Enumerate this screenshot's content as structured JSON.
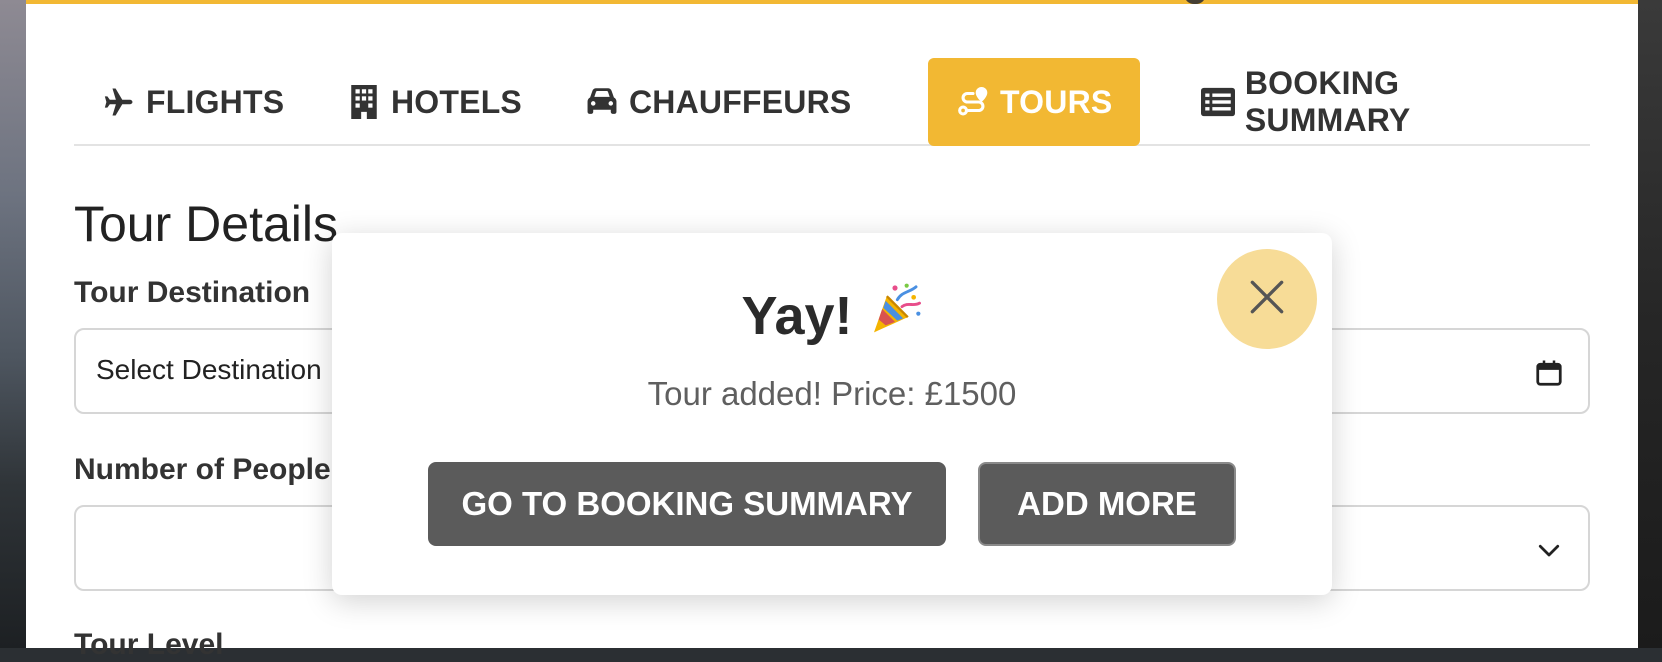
{
  "colors": {
    "accent": "#f2b833",
    "close_bg": "#f7dc97",
    "button_bg": "#5b5b5b",
    "text_dark": "#333333"
  },
  "tabs": [
    {
      "label": "FLIGHTS",
      "icon": "plane-icon",
      "active": false
    },
    {
      "label": "HOTELS",
      "icon": "building-icon",
      "active": false
    },
    {
      "label": "CHAUFFEURS",
      "icon": "car-icon",
      "active": false
    },
    {
      "label": "TOURS",
      "icon": "route-icon",
      "active": true
    },
    {
      "label": "BOOKING SUMMARY",
      "icon": "list-icon",
      "active": false
    }
  ],
  "form": {
    "section_title": "Tour Details",
    "destination_label": "Tour Destination",
    "destination_value": "Select Destination",
    "people_label": "Number of People",
    "people_value": "",
    "level_label": "Tour Level"
  },
  "modal": {
    "title": "Yay!",
    "title_emoji": "party-popper-icon",
    "message": "Tour added! Price: £1500",
    "primary_label": "GO TO BOOKING SUMMARY",
    "secondary_label": "ADD MORE",
    "close_icon": "close-icon"
  }
}
